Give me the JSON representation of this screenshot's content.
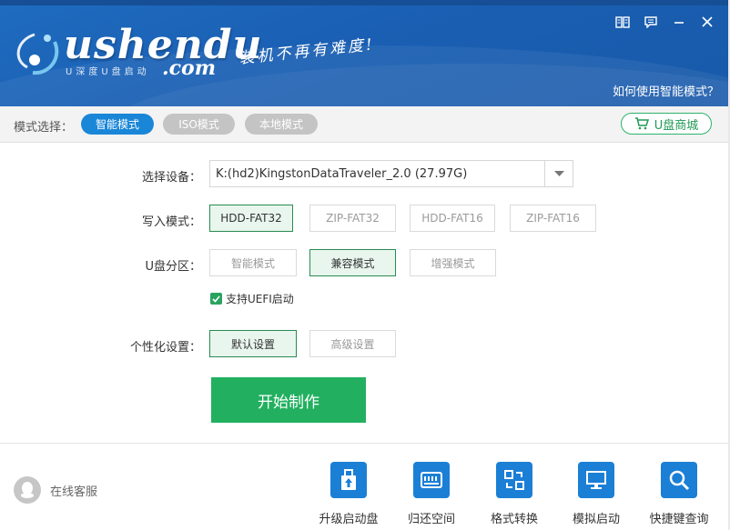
{
  "header": {
    "logo_main": "ushendu",
    "logo_sub": "U深度U盘启动",
    "logo_com": ".com",
    "slogan": "装机不再有难度!",
    "help_link": "如何使用智能模式？",
    "window_buttons": [
      "book-icon",
      "feedback-icon",
      "minimize-icon",
      "close-icon"
    ]
  },
  "modebar": {
    "label": "模式选择：",
    "modes": [
      {
        "label": "智能模式",
        "active": true
      },
      {
        "label": "ISO模式",
        "active": false
      },
      {
        "label": "本地模式",
        "active": false
      }
    ],
    "shop_label": "U盘商城"
  },
  "form": {
    "device_label": "选择设备：",
    "device_value": "K:(hd2)KingstonDataTraveler_2.0 (27.97G)",
    "write_label": "写入模式：",
    "write_options": [
      {
        "label": "HDD-FAT32",
        "selected": true
      },
      {
        "label": "ZIP-FAT32",
        "selected": false
      },
      {
        "label": "HDD-FAT16",
        "selected": false
      },
      {
        "label": "ZIP-FAT16",
        "selected": false
      }
    ],
    "partition_label": "U盘分区：",
    "partition_options": [
      {
        "label": "智能模式",
        "selected": false
      },
      {
        "label": "兼容模式",
        "selected": true
      },
      {
        "label": "增强模式",
        "selected": false
      }
    ],
    "uefi_label": "支持UEFI启动",
    "uefi_checked": true,
    "custom_label": "个性化设置：",
    "custom_options": [
      {
        "label": "默认设置",
        "selected": true
      },
      {
        "label": "高级设置",
        "selected": false
      }
    ],
    "start_label": "开始制作"
  },
  "footer": {
    "support_label": "在线客服",
    "tools": [
      {
        "label": "升级启动盘",
        "icon": "upgrade-icon"
      },
      {
        "label": "归还空间",
        "icon": "disk-icon"
      },
      {
        "label": "格式转换",
        "icon": "convert-icon"
      },
      {
        "label": "模拟启动",
        "icon": "monitor-icon"
      },
      {
        "label": "快捷键查询",
        "icon": "search-icon"
      }
    ]
  },
  "colors": {
    "header_blue": "#1a5fb3",
    "active_blue": "#1a86d8",
    "green": "#22b060",
    "tool_blue": "#1b7fd6"
  }
}
